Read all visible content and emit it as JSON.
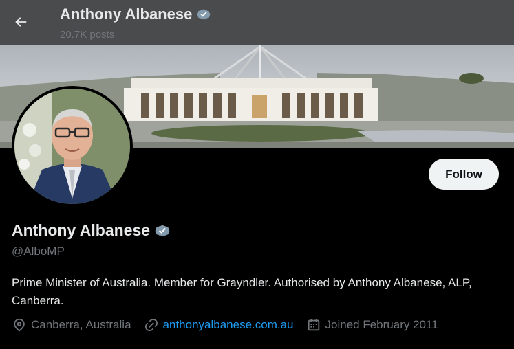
{
  "header": {
    "title": "Anthony Albanese",
    "posts_count": "20.7K posts"
  },
  "profile": {
    "name": "Anthony Albanese",
    "handle": "@AlboMP",
    "bio": "Prime Minister of Australia. Member for Grayndler. Authorised by Anthony Albanese, ALP, Canberra.",
    "location": "Canberra, Australia",
    "website": "anthonyalbanese.com.au",
    "joined": "Joined February 2011",
    "follow_label": "Follow",
    "verified_badge": "verified-badge-icon"
  },
  "colors": {
    "background": "#000000",
    "link": "#1d9bf0",
    "secondary_text": "#71767b",
    "verified_badge": "#829aab"
  }
}
